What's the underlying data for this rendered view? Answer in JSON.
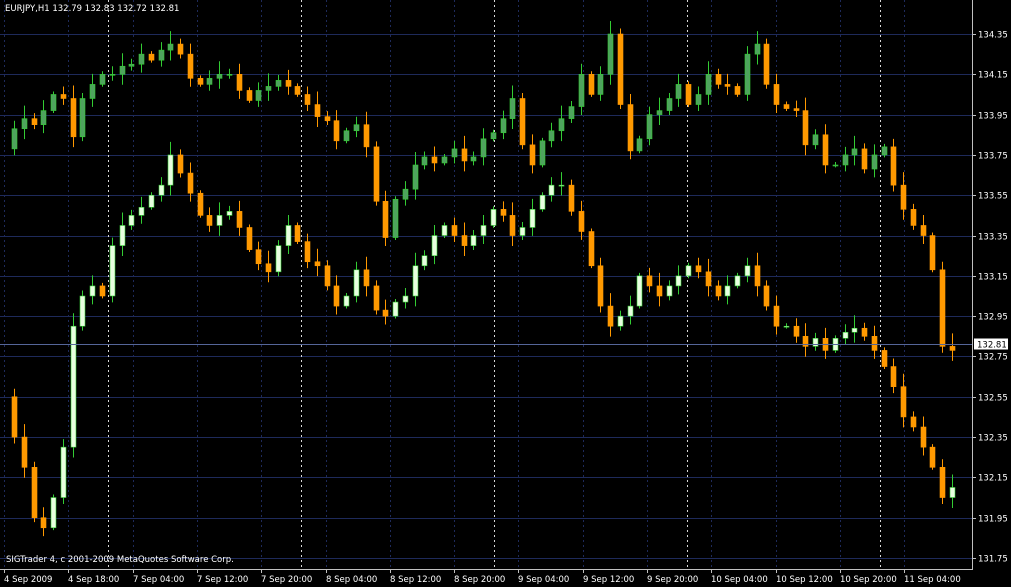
{
  "chart": {
    "symbol_line": "EURJPY,H1  132.79 132.83 132.72 132.81",
    "copyright": "SIGTrader 4, c 2001-2009 MetaQuotes Software Corp.",
    "current_price_label": "132.81"
  },
  "colors": {
    "background": "#000000",
    "grid": "#1e2a5a",
    "axis": "#c0c0c0",
    "bull_candle": "#4fa35e",
    "bear_candle": "#ff9900",
    "bull_candle_series2": "#e8ffe0",
    "bull_wick": "#33cc33",
    "price_line": "#556699"
  },
  "chart_data": {
    "type": "candlestick",
    "price_axis": {
      "labels": [
        "134.35",
        "134.15",
        "133.95",
        "133.75",
        "133.55",
        "133.35",
        "133.15",
        "132.95",
        "132.75",
        "132.55",
        "132.35",
        "132.15",
        "131.95",
        "131.75"
      ],
      "ylim": [
        131.75,
        134.35
      ]
    },
    "time_axis": {
      "labels": [
        "4 Sep 2009",
        "4 Sep 18:00",
        "7 Sep 04:00",
        "7 Sep 12:00",
        "7 Sep 20:00",
        "8 Sep 04:00",
        "8 Sep 12:00",
        "8 Sep 20:00",
        "9 Sep 04:00",
        "9 Sep 12:00",
        "9 Sep 20:00",
        "10 Sep 04:00",
        "10 Sep 12:00",
        "10 Sep 20:00",
        "11 Sep 04:00"
      ]
    },
    "current_price": 132.81,
    "series": [
      {
        "closes": [
          133.78,
          133.88,
          133.93,
          133.9,
          133.97,
          134.05,
          134.03,
          133.84,
          134.03,
          134.1,
          134.15,
          134.15,
          134.19,
          134.2,
          134.25,
          134.22,
          134.27,
          134.3,
          134.25,
          134.13,
          134.1,
          134.13,
          134.15,
          134.15,
          134.07,
          134.02,
          134.07,
          134.09,
          134.12,
          134.09,
          134.05,
          134.0,
          133.94,
          133.92,
          133.82,
          133.87,
          133.9,
          133.79,
          133.52,
          133.34,
          133.53,
          133.58,
          133.7,
          133.74,
          133.71,
          133.74,
          133.78,
          133.72,
          133.74,
          133.83,
          133.86,
          133.93,
          134.03,
          133.8,
          133.7,
          133.82,
          133.87,
          133.93,
          133.99,
          134.15,
          134.05,
          134.15,
          134.35,
          134.0,
          133.77,
          133.83,
          133.95,
          133.97,
          134.03,
          134.1,
          134.0,
          134.05,
          134.15,
          134.1,
          134.09,
          134.05,
          134.25,
          134.3,
          134.1,
          134.0,
          133.98,
          133.97,
          133.8,
          133.85,
          133.7,
          133.7,
          133.75,
          133.78,
          133.68,
          133.75,
          133.79,
          133.6,
          133.48,
          133.4,
          133.35,
          133.18,
          132.8,
          132.78
        ]
      },
      {
        "closes": [
          132.55,
          132.35,
          132.2,
          131.95,
          131.9,
          132.05,
          132.3,
          132.9,
          133.05,
          133.1,
          133.05,
          133.3,
          133.4,
          133.45,
          133.49,
          133.55,
          133.6,
          133.75,
          133.66,
          133.56,
          133.45,
          133.4,
          133.45,
          133.47,
          133.39,
          133.28,
          133.21,
          133.17,
          133.3,
          133.4,
          133.32,
          133.22,
          133.2,
          133.1,
          133.0,
          133.05,
          133.18,
          133.1,
          132.98,
          132.95,
          133.02,
          133.05,
          133.2,
          133.25,
          133.35,
          133.4,
          133.35,
          133.3,
          133.35,
          133.4,
          133.48,
          133.45,
          133.35,
          133.39,
          133.48,
          133.55,
          133.6,
          133.6,
          133.47,
          133.37,
          133.2,
          133.0,
          132.9,
          132.95,
          133.0,
          133.15,
          133.1,
          133.05,
          133.1,
          133.15,
          133.2,
          133.17,
          133.1,
          133.05,
          133.1,
          133.15,
          133.2,
          133.1,
          133.0,
          132.9,
          132.9,
          132.85,
          132.8,
          132.84,
          132.78,
          132.84,
          132.87,
          132.89,
          132.85,
          132.78,
          132.7,
          132.6,
          132.45,
          132.4,
          132.3,
          132.2,
          132.05,
          132.1
        ]
      }
    ]
  }
}
